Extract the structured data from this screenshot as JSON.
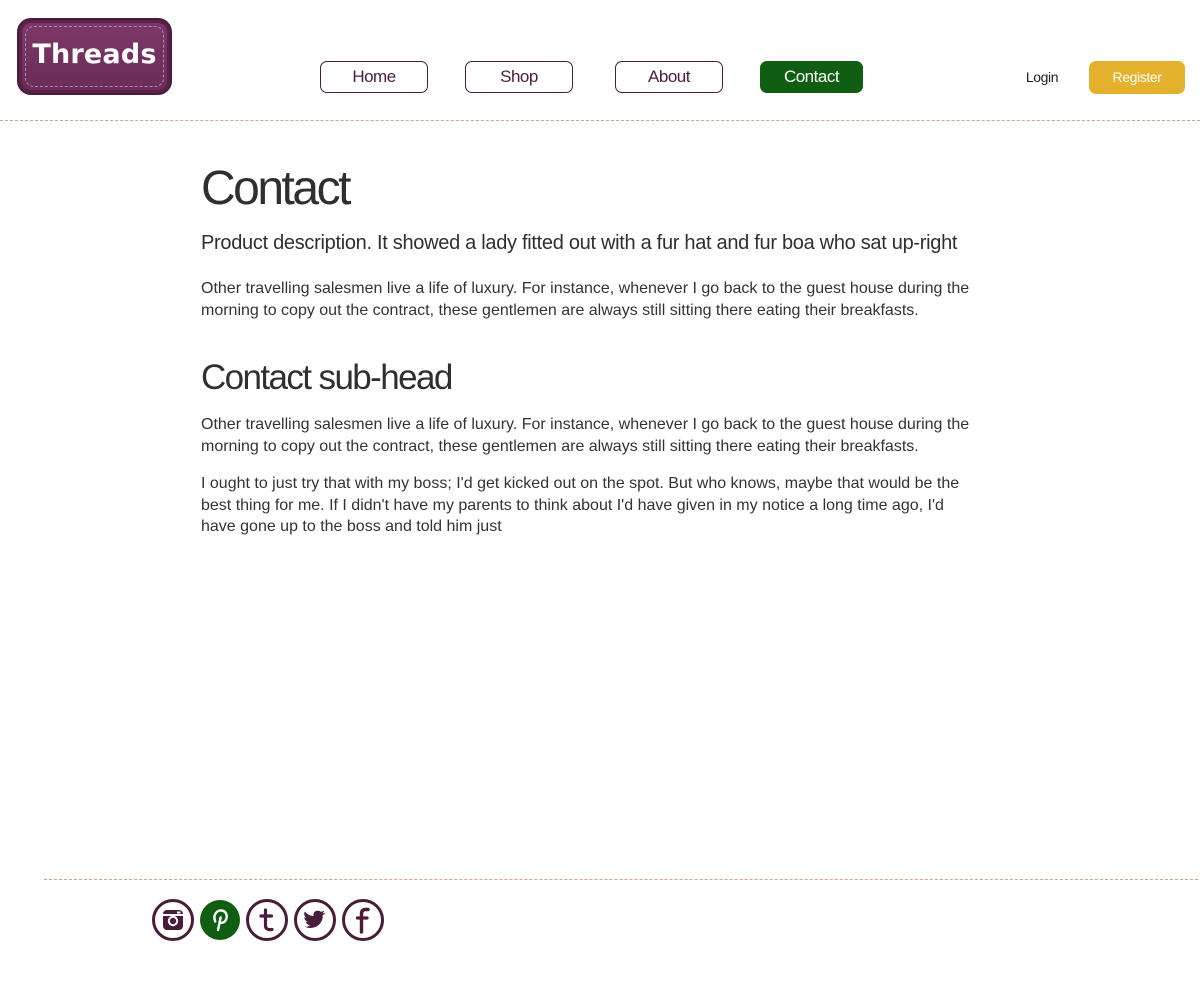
{
  "brand": {
    "logo_text": "Threads"
  },
  "nav": {
    "items": [
      {
        "label": "Home"
      },
      {
        "label": "Shop"
      },
      {
        "label": "About"
      },
      {
        "label": "Contact"
      }
    ]
  },
  "account": {
    "login": "Login",
    "register": "Register"
  },
  "main": {
    "title": "Contact",
    "lead": "Product description. It showed a lady fitted out with a fur hat and fur boa who sat up-right",
    "paragraph1": "Other travelling salesmen live a life of luxury. For instance, whenever I go back to the guest house during the morning to copy out the contract, these gentlemen are always still sitting there eating their breakfasts.",
    "subhead": "Contact sub-head",
    "paragraph2": "Other travelling salesmen live a life of luxury. For instance, whenever I go back to the guest house during the morning to copy out the contract, these gentlemen are always still sitting there eating their breakfasts.",
    "paragraph3": "I ought to just try that with my boss; I'd get kicked out on the spot. But who knows, maybe that would be the best thing for me. If I didn't have my parents to think about I'd have given in my notice a long time ago, I'd have gone up to the boss and told him just"
  },
  "social": {
    "icons": [
      "instagram-icon",
      "pinterest-icon",
      "tumblr-icon",
      "twitter-icon",
      "facebook-icon"
    ]
  },
  "colors": {
    "brand_purple": "#4a1c3c",
    "active_green": "#0f5e11",
    "register_gold": "#e3b12b",
    "divider": "#d4a388",
    "text": "#2f2f2f"
  }
}
